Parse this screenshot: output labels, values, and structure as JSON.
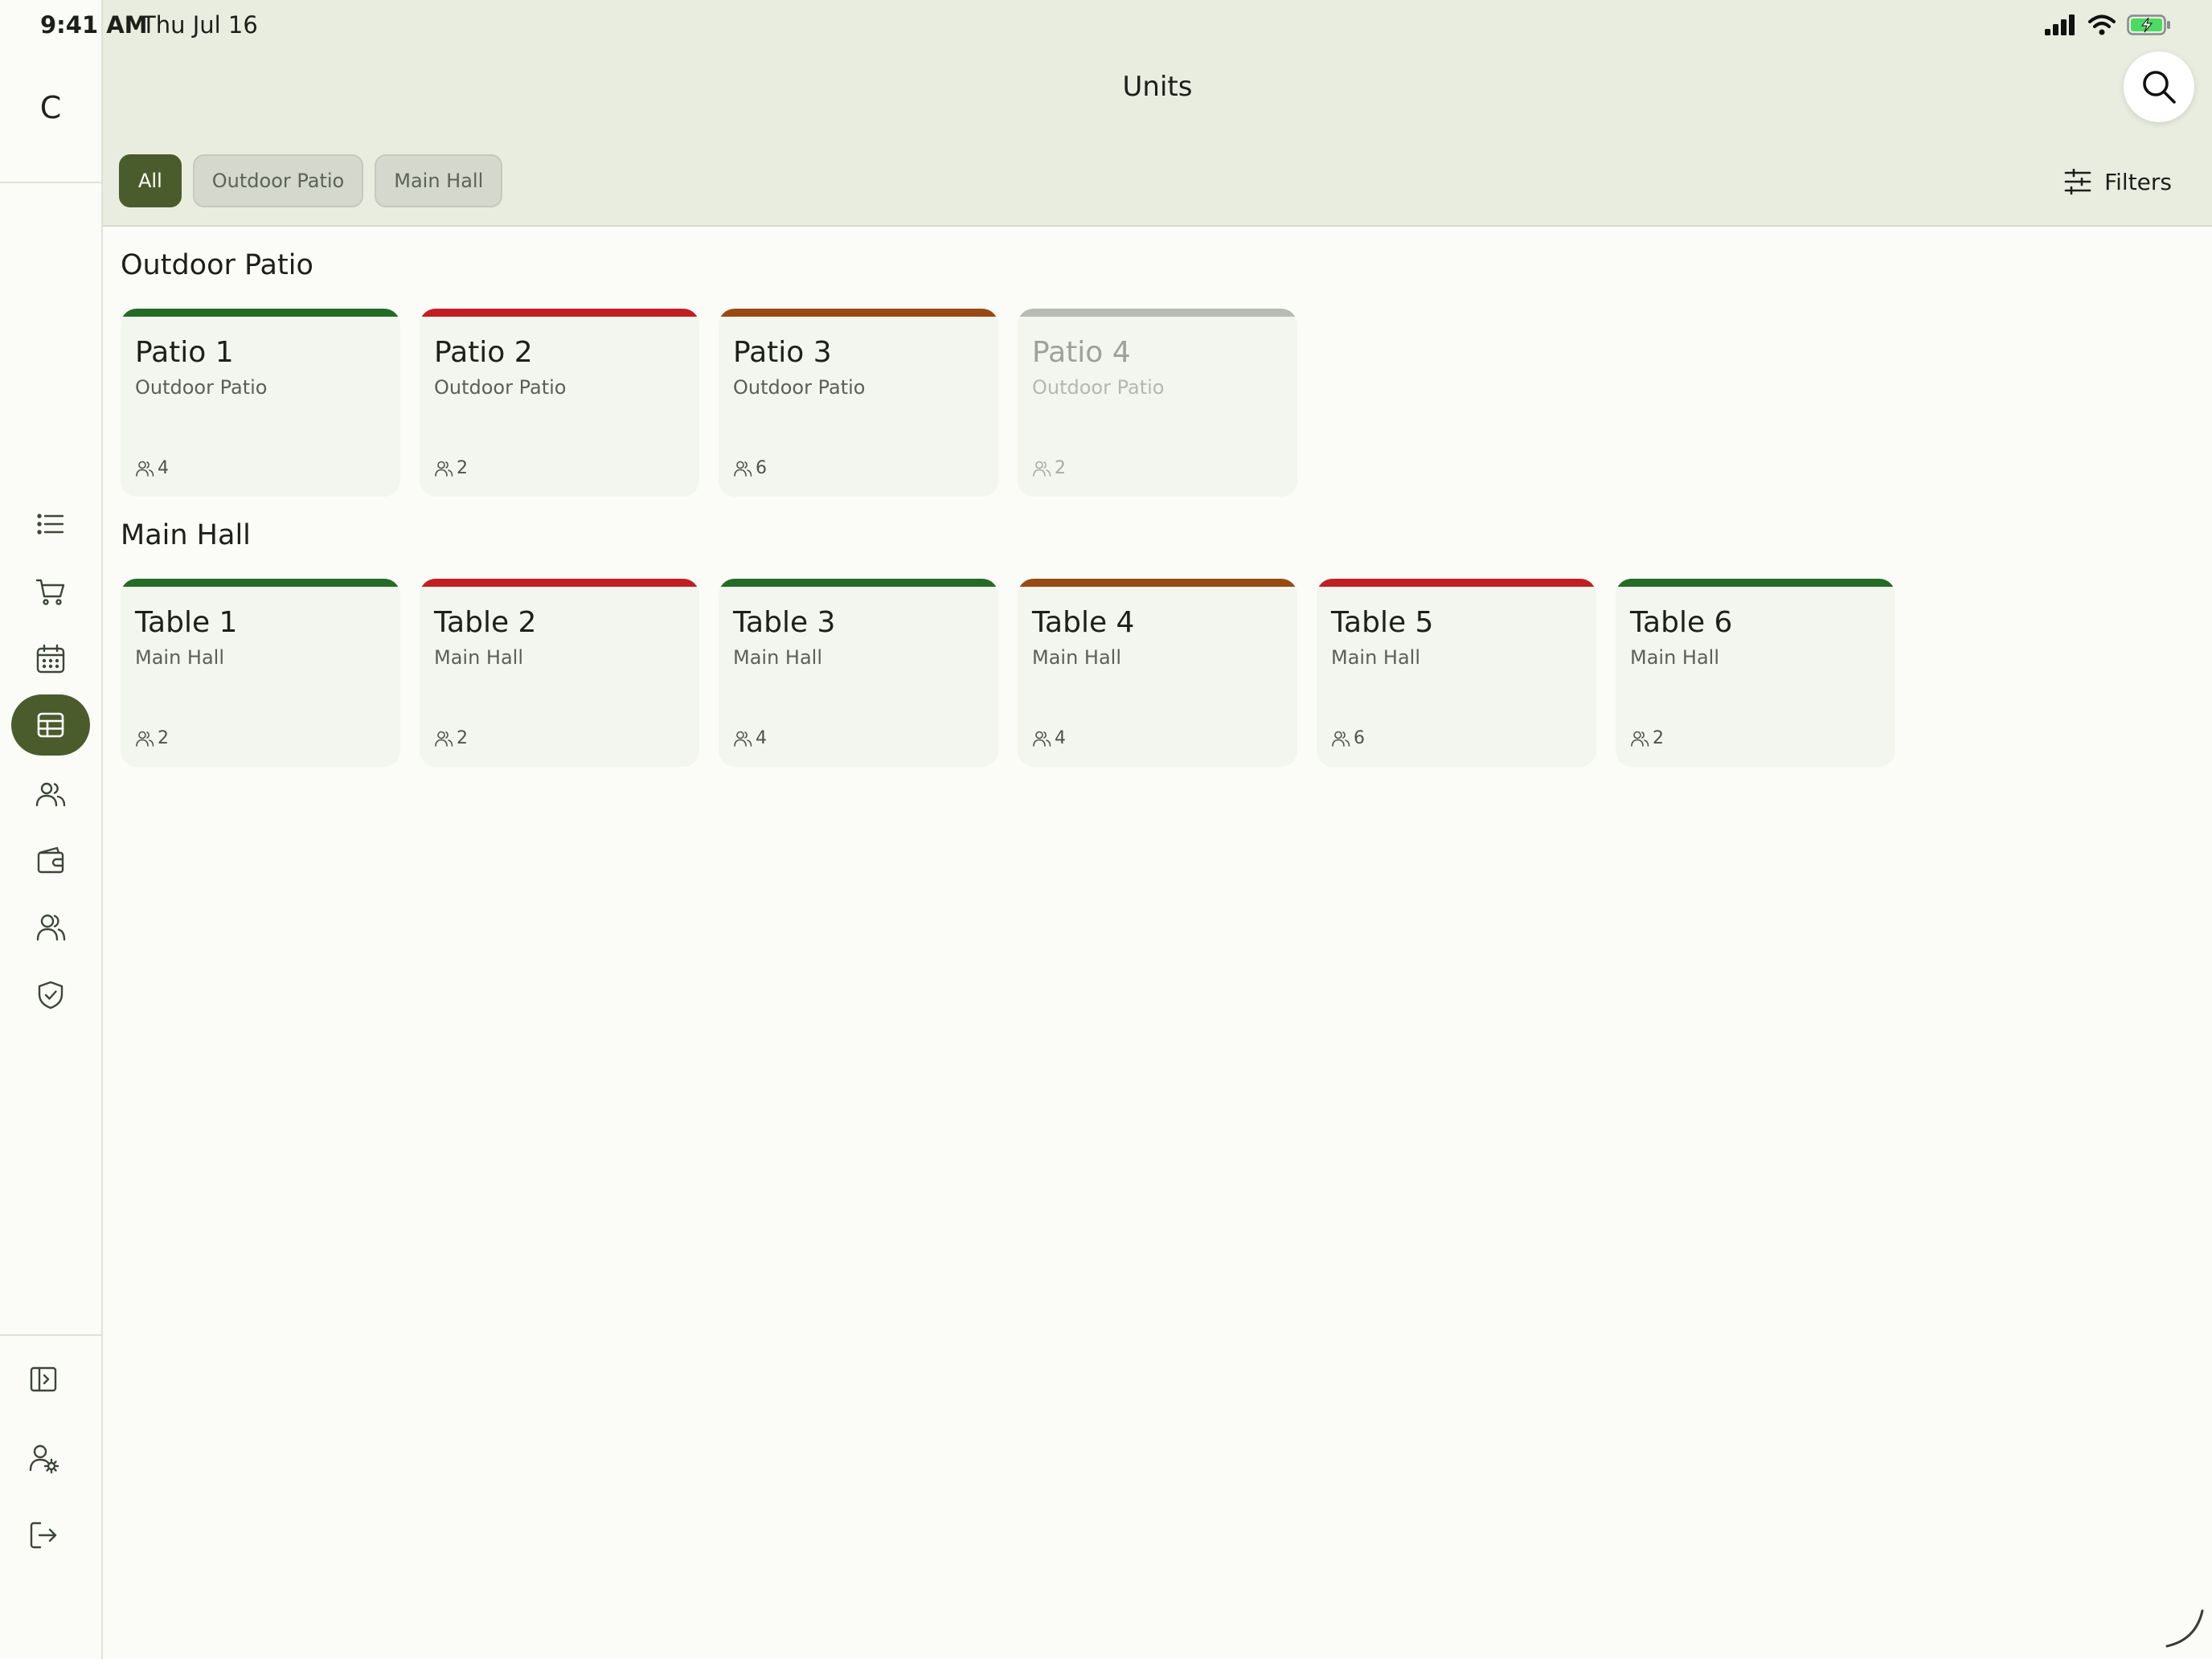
{
  "status_bar": {
    "time": "9:41 AM",
    "date": "Thu Jul 16"
  },
  "sidebar": {
    "brand": "C",
    "nav_icons": [
      "list-icon",
      "cart-icon",
      "calendar-icon",
      "table-icon",
      "users-icon",
      "wallet-icon",
      "team-icon",
      "shield-check-icon"
    ],
    "active": "table-icon",
    "bottom_icons": [
      "sidebar-expand-icon",
      "user-settings-icon",
      "logout-icon"
    ]
  },
  "header": {
    "title": "Units",
    "chips": [
      {
        "label": "All",
        "active": true
      },
      {
        "label": "Outdoor Patio",
        "active": false
      },
      {
        "label": "Main Hall",
        "active": false
      }
    ],
    "filters_label": "Filters"
  },
  "colors": {
    "accent": "#4a5c2c",
    "status_green": "#236b26",
    "status_red": "#c21e22",
    "status_orange": "#984a12",
    "status_gray": "#b8bab5"
  },
  "sections": [
    {
      "title": "Outdoor Patio",
      "units": [
        {
          "name": "Patio 1",
          "area": "Outdoor Patio",
          "seats": "4",
          "status": "green"
        },
        {
          "name": "Patio 2",
          "area": "Outdoor Patio",
          "seats": "2",
          "status": "red"
        },
        {
          "name": "Patio 3",
          "area": "Outdoor Patio",
          "seats": "6",
          "status": "orange"
        },
        {
          "name": "Patio 4",
          "area": "Outdoor Patio",
          "seats": "2",
          "status": "gray"
        }
      ]
    },
    {
      "title": "Main Hall",
      "units": [
        {
          "name": "Table 1",
          "area": "Main Hall",
          "seats": "2",
          "status": "green"
        },
        {
          "name": "Table 2",
          "area": "Main Hall",
          "seats": "2",
          "status": "red"
        },
        {
          "name": "Table 3",
          "area": "Main Hall",
          "seats": "4",
          "status": "green"
        },
        {
          "name": "Table 4",
          "area": "Main Hall",
          "seats": "4",
          "status": "orange"
        },
        {
          "name": "Table 5",
          "area": "Main Hall",
          "seats": "6",
          "status": "red"
        },
        {
          "name": "Table 6",
          "area": "Main Hall",
          "seats": "2",
          "status": "green"
        }
      ]
    }
  ]
}
